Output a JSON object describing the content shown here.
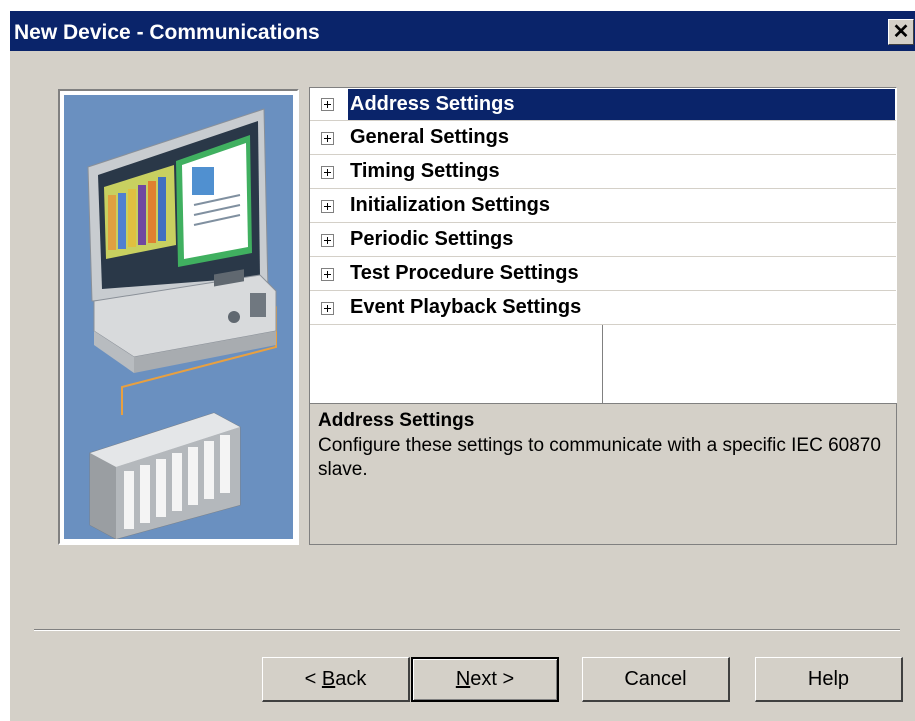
{
  "window": {
    "title": "New Device - Communications",
    "close_glyph": "✕",
    "close_icon": "close-icon"
  },
  "illustration": {
    "icon": "computer-plc-network-illustration"
  },
  "tree": {
    "items": [
      {
        "label": "Address Settings",
        "selected": true
      },
      {
        "label": "General Settings",
        "selected": false
      },
      {
        "label": "Timing Settings",
        "selected": false
      },
      {
        "label": "Initialization Settings",
        "selected": false
      },
      {
        "label": "Periodic Settings",
        "selected": false
      },
      {
        "label": "Test Procedure Settings",
        "selected": false
      },
      {
        "label": "Event Playback Settings",
        "selected": false
      }
    ],
    "expander_icon": "plus-box-icon"
  },
  "description": {
    "title": "Address Settings",
    "body": "Configure these settings to communicate with a specific IEC 60870 slave."
  },
  "buttons": {
    "back": {
      "prefix": "< ",
      "accel": "B",
      "rest": "ack"
    },
    "next": {
      "accel": "N",
      "rest": "ext >"
    },
    "cancel": "Cancel",
    "help": "Help"
  },
  "colors": {
    "titlebar": "#0a246a",
    "dialog_bg": "#d4d0c8",
    "selection": "#0a246a",
    "illustration_bg": "#6a90c0"
  }
}
